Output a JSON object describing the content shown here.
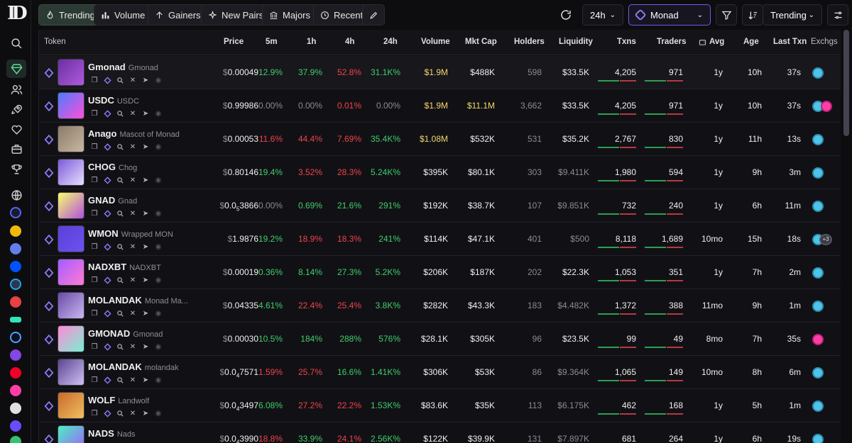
{
  "toolbar": {
    "filters": [
      {
        "label": "Trending",
        "icon": "flame-icon",
        "active": true
      },
      {
        "label": "Volume",
        "icon": "bar-chart-icon",
        "active": false
      },
      {
        "label": "Gainers",
        "icon": "arrow-up-icon",
        "active": false
      },
      {
        "label": "New Pairs",
        "icon": "sparkle-icon",
        "active": false
      },
      {
        "label": "Majors",
        "icon": "bank-icon",
        "active": false
      },
      {
        "label": "Recent",
        "icon": "history-icon",
        "active": false
      }
    ],
    "timeframe": "24h",
    "chain": "Monad",
    "sort": "Trending"
  },
  "columns": {
    "token": "Token",
    "price": "Price",
    "m5": "5m",
    "h1": "1h",
    "h4": "4h",
    "h24": "24h",
    "volume": "Volume",
    "mcap": "Mkt Cap",
    "holders": "Holders",
    "liquidity": "Liquidity",
    "txns": "Txns",
    "traders": "Traders",
    "avg": "Avg",
    "age": "Age",
    "last": "Last Txn",
    "exchs": "Exchgs"
  },
  "rows": [
    {
      "name": "Gmonad",
      "sub": "Gmonad",
      "price_pre": "$",
      "price_main": "0.00049",
      "price_sub": "",
      "price_tail": "",
      "m5": "12.9%",
      "m5c": "pos",
      "h1": "37.9%",
      "h1c": "pos",
      "h4": "52.8%",
      "h4c": "neg",
      "h24": "31.1K%",
      "h24c": "pos",
      "volume": "$1.9M",
      "volc": "yellow",
      "mcap": "$488K",
      "mcapc": "",
      "holders": "598",
      "liquidity": "$33.5K",
      "liqc": "",
      "txns": "4,205",
      "traders": "971",
      "avg": "1y",
      "age": "10h",
      "last": "37s",
      "exchs": 1,
      "avatar": [
        "#6a2fa0",
        "#b05adf"
      ]
    },
    {
      "name": "USDC",
      "sub": "USDC",
      "price_pre": "$",
      "price_main": "0.99986",
      "price_sub": "",
      "price_tail": "",
      "m5": "0.00%",
      "m5c": "muted",
      "h1": "0.00%",
      "h1c": "muted",
      "h4": "0.01%",
      "h4c": "neg",
      "h24": "0.00%",
      "h24c": "muted",
      "volume": "$1.9M",
      "volc": "yellow",
      "mcap": "$11.1M",
      "mcapc": "yellow",
      "holders": "3,662",
      "liquidity": "$33.5K",
      "liqc": "",
      "txns": "4,205",
      "traders": "971",
      "avg": "1y",
      "age": "10h",
      "last": "37s",
      "exchs": 2,
      "avatar": [
        "#4a7cff",
        "#ff4fd8"
      ]
    },
    {
      "name": "Anago",
      "sub": "Mascot of Monad",
      "price_pre": "$",
      "price_main": "0.00053",
      "price_sub": "",
      "price_tail": "",
      "m5": "11.6%",
      "m5c": "neg",
      "h1": "44.4%",
      "h1c": "neg",
      "h4": "7.69%",
      "h4c": "neg",
      "h24": "35.4K%",
      "h24c": "pos",
      "volume": "$1.08M",
      "volc": "yellow",
      "mcap": "$532K",
      "mcapc": "",
      "holders": "531",
      "liquidity": "$35.2K",
      "liqc": "",
      "txns": "2,767",
      "traders": "830",
      "avg": "1y",
      "age": "11h",
      "last": "13s",
      "exchs": 1,
      "avatar": [
        "#8a7a6a",
        "#c9b8a0"
      ]
    },
    {
      "name": "CHOG",
      "sub": "Chog",
      "price_pre": "$",
      "price_main": "0.80146",
      "price_sub": "",
      "price_tail": "",
      "m5": "19.4%",
      "m5c": "pos",
      "h1": "3.52%",
      "h1c": "neg",
      "h4": "28.3%",
      "h4c": "neg",
      "h24": "5.24K%",
      "h24c": "pos",
      "volume": "$395K",
      "volc": "",
      "mcap": "$80.1K",
      "mcapc": "",
      "holders": "303",
      "liquidity": "$9.411K",
      "liqc": "muted",
      "txns": "1,980",
      "traders": "594",
      "avg": "1y",
      "age": "9h",
      "last": "3m",
      "exchs": 1,
      "avatar": [
        "#7a5ad8",
        "#e8e0ff"
      ]
    },
    {
      "name": "GNAD",
      "sub": "Gnad",
      "price_pre": "$",
      "price_main": "0.0",
      "price_sub": "5",
      "price_tail": "3866",
      "m5": "0.00%",
      "m5c": "muted",
      "h1": "0.69%",
      "h1c": "pos",
      "h4": "21.6%",
      "h4c": "pos",
      "h24": "291%",
      "h24c": "pos",
      "volume": "$192K",
      "volc": "",
      "mcap": "$38.7K",
      "mcapc": "",
      "holders": "107",
      "liquidity": "$9.851K",
      "liqc": "muted",
      "txns": "732",
      "traders": "240",
      "avg": "1y",
      "age": "6h",
      "last": "11m",
      "exchs": 1,
      "avatar": [
        "#f7ff6a",
        "#b34fe0"
      ]
    },
    {
      "name": "WMON",
      "sub": "Wrapped MON",
      "price_pre": "$",
      "price_main": "1.9876",
      "price_sub": "",
      "price_tail": "",
      "m5": "19.2%",
      "m5c": "pos",
      "h1": "18.9%",
      "h1c": "neg",
      "h4": "18.3%",
      "h4c": "neg",
      "h24": "241%",
      "h24c": "pos",
      "volume": "$114K",
      "volc": "",
      "mcap": "$47.1K",
      "mcapc": "",
      "holders": "401",
      "liquidity": "$500",
      "liqc": "muted",
      "txns": "8,118",
      "traders": "1,689",
      "avg": "10mo",
      "age": "15h",
      "last": "18s",
      "exchs": 3,
      "avatar": [
        "#5b3fd6",
        "#6d52f0"
      ]
    },
    {
      "name": "NADXBT",
      "sub": "NADXBT",
      "price_pre": "$",
      "price_main": "0.00019",
      "price_sub": "",
      "price_tail": "",
      "m5": "0.36%",
      "m5c": "pos",
      "h1": "8.14%",
      "h1c": "pos",
      "h4": "27.3%",
      "h4c": "pos",
      "h24": "5.2K%",
      "h24c": "pos",
      "volume": "$206K",
      "volc": "",
      "mcap": "$187K",
      "mcapc": "",
      "holders": "202",
      "liquidity": "$22.3K",
      "liqc": "",
      "txns": "1,053",
      "traders": "351",
      "avg": "1y",
      "age": "7h",
      "last": "2m",
      "exchs": 1,
      "avatar": [
        "#a35cff",
        "#ff7cd6"
      ]
    },
    {
      "name": "MOLANDAK",
      "sub": "Monad Ma...",
      "price_pre": "$",
      "price_main": "0.04335",
      "price_sub": "",
      "price_tail": "",
      "m5": "4.61%",
      "m5c": "pos",
      "h1": "22.4%",
      "h1c": "neg",
      "h4": "25.4%",
      "h4c": "neg",
      "h24": "3.8K%",
      "h24c": "pos",
      "volume": "$282K",
      "volc": "",
      "mcap": "$43.3K",
      "mcapc": "",
      "holders": "183",
      "liquidity": "$4.482K",
      "liqc": "muted",
      "txns": "1,372",
      "traders": "388",
      "avg": "11mo",
      "age": "9h",
      "last": "1m",
      "exchs": 1,
      "avatar": [
        "#6a4aa8",
        "#c8b8f0"
      ]
    },
    {
      "name": "GMONAD",
      "sub": "Gmonad",
      "price_pre": "$",
      "price_main": "0.00030",
      "price_sub": "",
      "price_tail": "",
      "m5": "10.5%",
      "m5c": "pos",
      "h1": "184%",
      "h1c": "pos",
      "h4": "288%",
      "h4c": "pos",
      "h24": "576%",
      "h24c": "pos",
      "volume": "$28.1K",
      "volc": "",
      "mcap": "$305K",
      "mcapc": "",
      "holders": "96",
      "liquidity": "$23.5K",
      "liqc": "",
      "txns": "99",
      "traders": "49",
      "avg": "8mo",
      "age": "7h",
      "last": "35s",
      "exchs": 4,
      "avatar": [
        "#ff8ad8",
        "#7af0d0"
      ]
    },
    {
      "name": "MOLANDAK",
      "sub": "molandak",
      "price_pre": "$",
      "price_main": "0.0",
      "price_sub": "4",
      "price_tail": "7571",
      "m5": "1.59%",
      "m5c": "neg",
      "h1": "25.7%",
      "h1c": "neg",
      "h4": "16.6%",
      "h4c": "pos",
      "h24": "1.41K%",
      "h24c": "pos",
      "volume": "$306K",
      "volc": "",
      "mcap": "$53K",
      "mcapc": "",
      "holders": "86",
      "liquidity": "$9.364K",
      "liqc": "muted",
      "txns": "1,065",
      "traders": "149",
      "avg": "10mo",
      "age": "8h",
      "last": "6m",
      "exchs": 1,
      "avatar": [
        "#5a4590",
        "#d0c0f5"
      ]
    },
    {
      "name": "WOLF",
      "sub": "Landwolf",
      "price_pre": "$",
      "price_main": "0.0",
      "price_sub": "4",
      "price_tail": "3497",
      "m5": "6.08%",
      "m5c": "pos",
      "h1": "27.2%",
      "h1c": "neg",
      "h4": "22.2%",
      "h4c": "neg",
      "h24": "1.53K%",
      "h24c": "pos",
      "volume": "$83.6K",
      "volc": "",
      "mcap": "$35K",
      "mcapc": "",
      "holders": "113",
      "liquidity": "$6.175K",
      "liqc": "muted",
      "txns": "462",
      "traders": "168",
      "avg": "1y",
      "age": "5h",
      "last": "1m",
      "exchs": 1,
      "avatar": [
        "#c86a2a",
        "#f0c060"
      ]
    },
    {
      "name": "NADS",
      "sub": "Nads",
      "price_pre": "$",
      "price_main": "0.0",
      "price_sub": "4",
      "price_tail": "3990",
      "m5": "18.8%",
      "m5c": "neg",
      "h1": "33.9%",
      "h1c": "pos",
      "h4": "24.1%",
      "h4c": "neg",
      "h24": "2.56K%",
      "h24c": "pos",
      "volume": "$122K",
      "volc": "",
      "mcap": "$39.9K",
      "mcapc": "",
      "holders": "131",
      "liquidity": "$7.897K",
      "liqc": "muted",
      "txns": "681",
      "traders": "264",
      "avg": "1y",
      "age": "6h",
      "last": "19s",
      "exchs": 1,
      "avatar": [
        "#4af0c0",
        "#a35cff"
      ]
    }
  ],
  "exch_more": "+3"
}
